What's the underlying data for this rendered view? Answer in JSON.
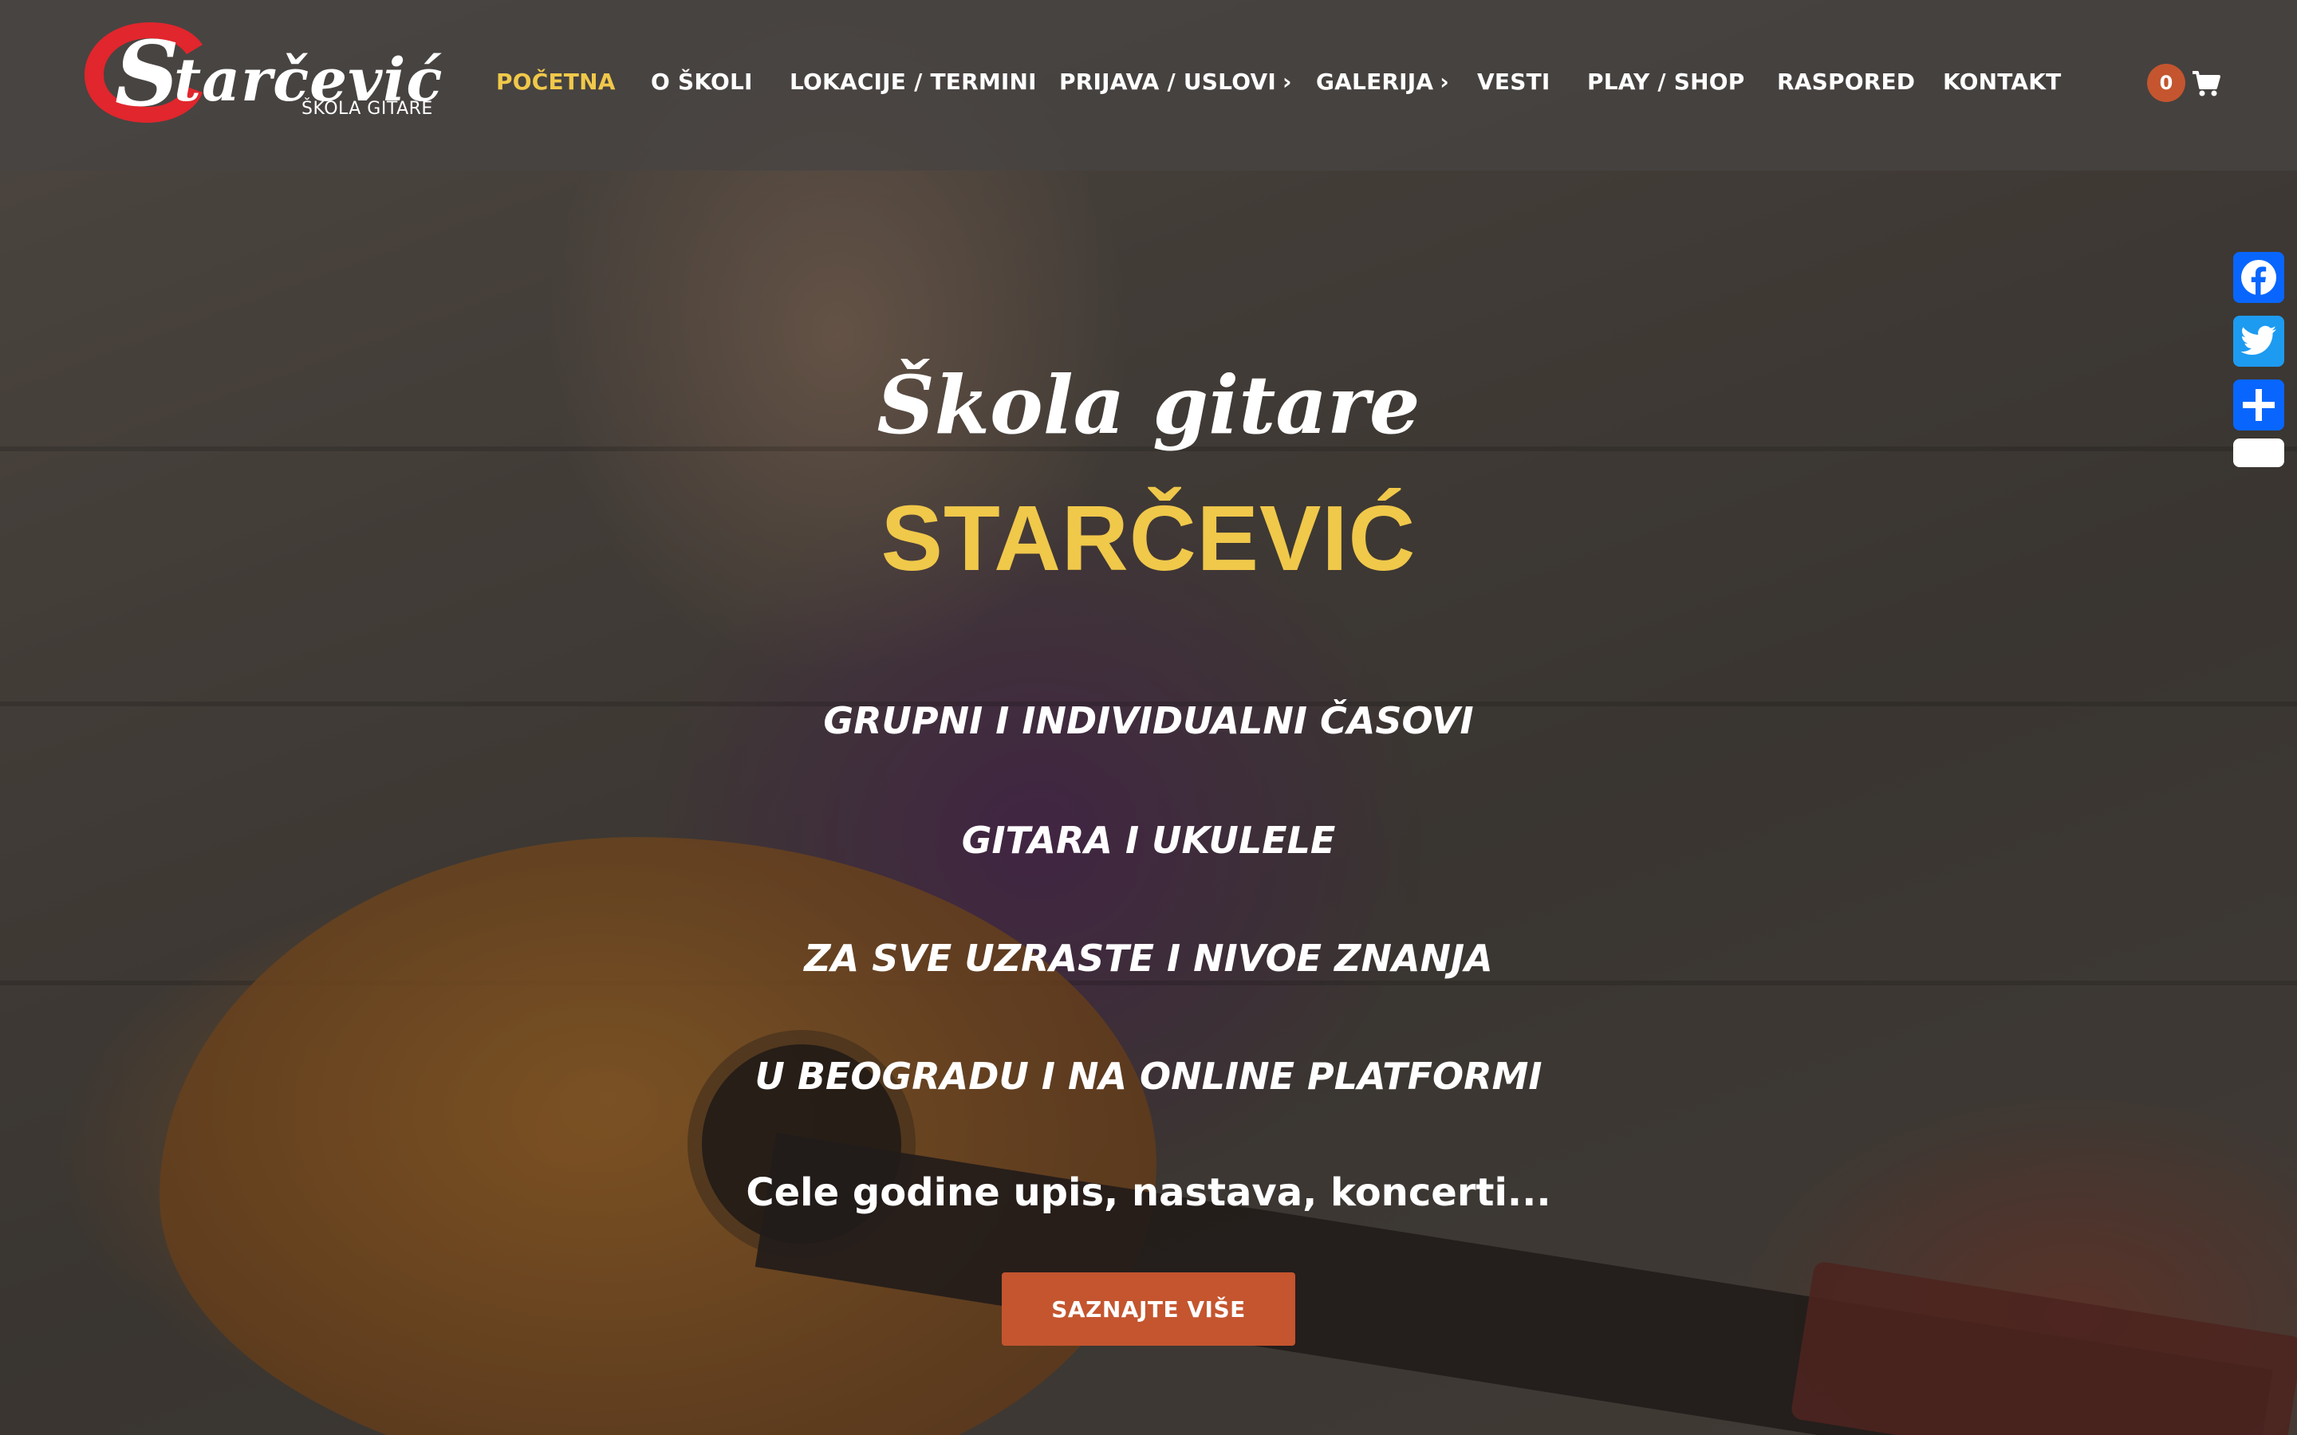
{
  "logo": {
    "word": "tarčević",
    "subtitle": "ŠKOLA GITARE",
    "accent_color": "#e1262d"
  },
  "nav": {
    "items": [
      {
        "label": "POČETNA",
        "active": true
      },
      {
        "label": "O ŠKOLI"
      },
      {
        "label": "LOKACIJE / TERMINI"
      },
      {
        "label": "PRIJAVA / USLOVI",
        "has_submenu": true
      },
      {
        "label": "GALERIJA",
        "has_submenu": true
      },
      {
        "label": "VESTI"
      },
      {
        "label": "PLAY / SHOP"
      },
      {
        "label": "RASPORED"
      },
      {
        "label": "KONTAKT"
      }
    ],
    "submenu_chevron": "›",
    "active_color": "#f0c84a"
  },
  "cart": {
    "count": "0",
    "icon": "shopping-cart-icon",
    "badge_color": "#c4552f"
  },
  "hero": {
    "script_title": "Škola gitare",
    "brand": "STARČEVIĆ",
    "lines": [
      "GRUPNI I INDIVIDUALNI ČASOVI",
      "GITARA I UKULELE",
      "ZA SVE UZRASTE I NIVOE ZNANJA",
      "U BEOGRADU I NA ONLINE PLATFORMI"
    ],
    "tagline": "Cele godine upis, nastava, koncerti...",
    "cta_label": "SAZNAJTE VIŠE",
    "cta_color": "#c4552f",
    "brand_color": "#f0c84a"
  },
  "share": {
    "buttons": [
      {
        "icon": "facebook-icon",
        "color": "#0866ff"
      },
      {
        "icon": "twitter-icon",
        "color": "#1d9bf0"
      },
      {
        "icon": "share-plus-icon",
        "color": "#0866ff"
      },
      {
        "icon": "minimize-icon",
        "color": "#ffffff"
      }
    ]
  }
}
